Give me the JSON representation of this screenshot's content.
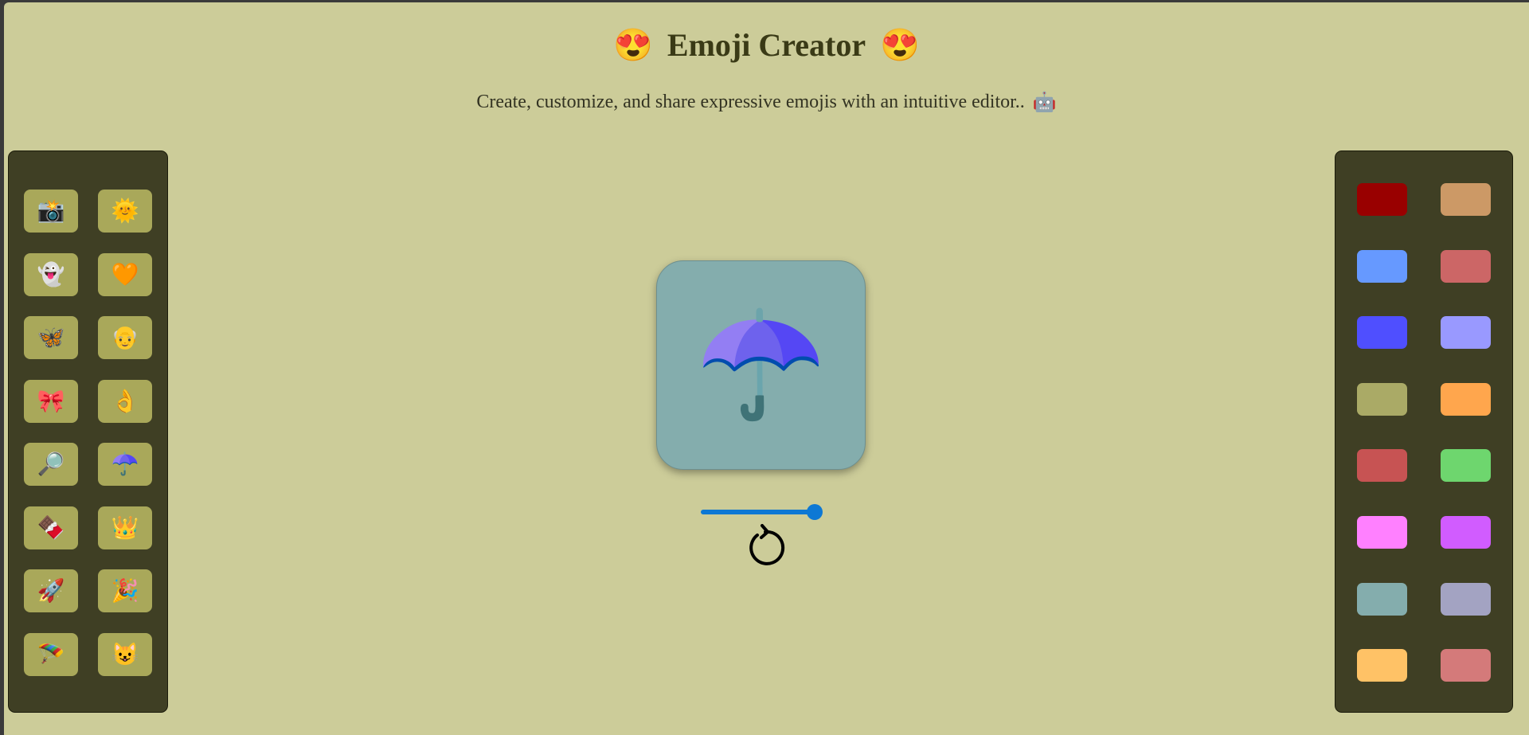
{
  "header": {
    "title": "Emoji Creator",
    "title_emoji": "😍",
    "subtitle": "Create, customize, and share expressive emojis with an intuitive editor..",
    "subtitle_emoji": "🤖"
  },
  "emoji_palette": [
    {
      "name": "camera-with-flash",
      "char": "📸"
    },
    {
      "name": "smiling-sun",
      "char": "🌞"
    },
    {
      "name": "ghost",
      "char": "👻"
    },
    {
      "name": "orange-heart",
      "char": "🧡"
    },
    {
      "name": "butterfly",
      "char": "🦋"
    },
    {
      "name": "old-man",
      "char": "👴"
    },
    {
      "name": "ribbon",
      "char": "🎀"
    },
    {
      "name": "ok-hand",
      "char": "👌"
    },
    {
      "name": "magnifying-glass",
      "char": "🔎"
    },
    {
      "name": "umbrella",
      "char": "☂️"
    },
    {
      "name": "chocolate-bar",
      "char": "🍫"
    },
    {
      "name": "crown",
      "char": "👑"
    },
    {
      "name": "rocket",
      "char": "🚀"
    },
    {
      "name": "party-popper",
      "char": "🎉"
    },
    {
      "name": "parachute",
      "char": "🪂"
    },
    {
      "name": "smiling-cat",
      "char": "😺"
    }
  ],
  "color_palette": [
    "#990000",
    "#cc9966",
    "#6699ff",
    "#cc6666",
    "#4f4fff",
    "#9999ff",
    "#aaaa66",
    "#ffa64d",
    "#c75353",
    "#6ed66e",
    "#ff80ff",
    "#d15cff",
    "#84adad",
    "#a3a3c2",
    "#ffc266",
    "#d47a7a"
  ],
  "editor": {
    "current_emoji": "☂️",
    "background_color": "#84adad",
    "size_slider_value": 1.0,
    "reset_icon": "rotate-ccw-icon"
  }
}
